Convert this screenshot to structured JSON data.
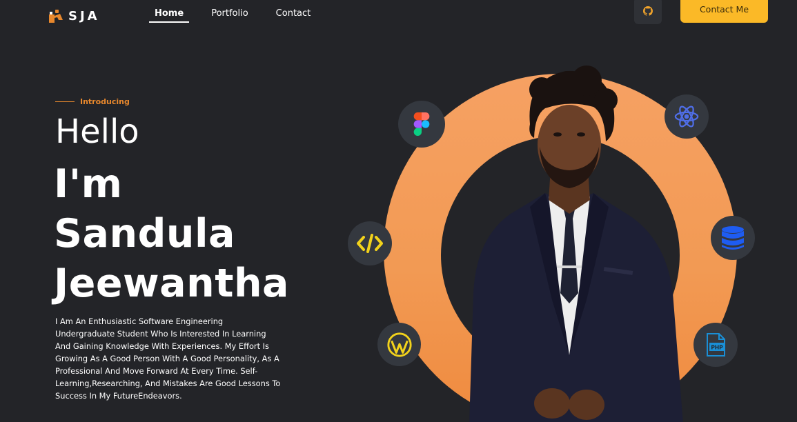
{
  "header": {
    "logo_text": "SJA",
    "nav": [
      {
        "label": "Home",
        "active": true
      },
      {
        "label": "Portfolio",
        "active": false
      },
      {
        "label": "Contact",
        "active": false
      }
    ],
    "github_icon": "github-icon",
    "contact_button_label": "Contact Me"
  },
  "hero": {
    "introducing": "Introducing",
    "greeting": "Hello",
    "im": "I'm",
    "first_name": "Sandula",
    "last_name": "Jeewantha",
    "bio": "I Am An Enthusiastic Software Engineering Undergraduate Student Who Is Interested In Learning And Gaining Knowledge With Experiences. My Effort Is Growing As A Good Person With A Good Personality, As A Professional And Move Forward At Every Time. Self-Learning,Researching, And Mistakes Are Good Lessons To Success In My FutureEndeavors."
  },
  "tech_icons": [
    "figma-icon",
    "react-icon",
    "code-icon",
    "database-icon",
    "wordpress-icon",
    "php-icon"
  ],
  "colors": {
    "background": "#232428",
    "accent_orange": "#f29a54",
    "button_yellow": "#fbb927",
    "icon_circle": "#34383f"
  }
}
